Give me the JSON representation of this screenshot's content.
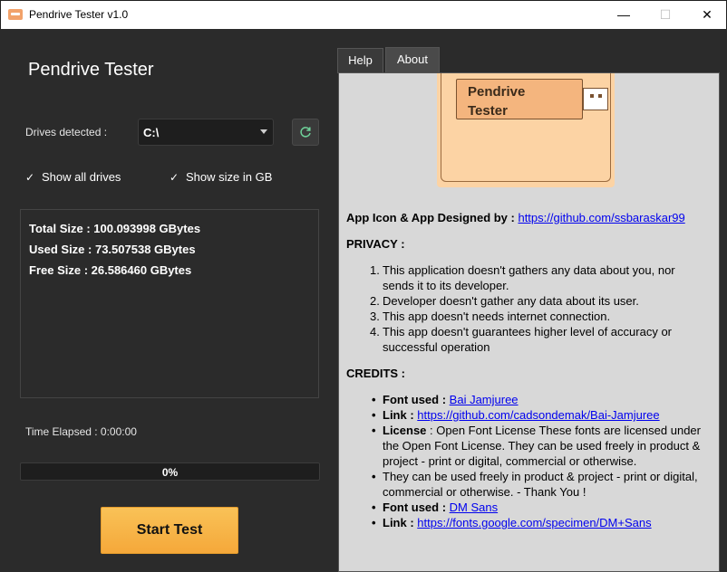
{
  "window": {
    "title": "Pendrive Tester v1.0",
    "minimize_glyph": "—",
    "maximize_glyph": "☐",
    "close_glyph": "✕"
  },
  "left": {
    "app_title": "Pendrive Tester",
    "drives_label": "Drives detected :",
    "drive_value": "C:\\",
    "refresh_icon": "refresh-icon",
    "show_all_drives": {
      "mark": "✓",
      "label": "Show all drives",
      "checked": true
    },
    "show_size_gb": {
      "mark": "✓",
      "label": "Show size in GB",
      "checked": true
    },
    "info": {
      "total": "Total Size : 100.093998 GBytes",
      "used": "Used Size : 73.507538 GBytes",
      "free": "Free Size : 26.586460 GBytes"
    },
    "time_elapsed": "Time Elapsed : 0:00:00",
    "progress_percent": 0,
    "progress_label": "0%",
    "start_button": "Start Test"
  },
  "tabs": [
    {
      "label": "Help",
      "active": false
    },
    {
      "label": "About",
      "active": true
    }
  ],
  "about": {
    "logo_text_line1": "Pendrive",
    "logo_text_line2": "Tester",
    "designer_label": "App Icon & App Designed by : ",
    "designer_link": "https://github.com/ssbaraskar99",
    "privacy_heading": "PRIVACY :",
    "privacy_items": [
      {
        "num": "1.",
        "text": "This application doesn't gathers any data about you, nor sends it to its developer."
      },
      {
        "num": "2.",
        "text": "Developer doesn't gather any data about its user."
      },
      {
        "num": "3.",
        "text": "This app doesn't needs internet connection."
      },
      {
        "num": "4.",
        "text": "This app doesn't guarantees higher level of accuracy or successful operation"
      }
    ],
    "credits_heading": "CREDITS :",
    "credits": {
      "font1_label": "Font used : ",
      "font1_link": "Bai Jamjuree",
      "link1_label": "Link : ",
      "link1_url": "https://github.com/cadsondemak/Bai-Jamjuree",
      "license_label": "License",
      "license_text": " : Open Font License These fonts are licensed under the Open Font License. They can be used freely in product & project - print or digital, commercial or otherwise.",
      "freely_text": "They can be used freely in product & project - print or digital, commercial or otherwise. - Thank You !",
      "font2_label": "Font used : ",
      "font2_link": "DM Sans",
      "link2_label": "Link : ",
      "link2_url": "https://fonts.google.com/specimen/DM+Sans",
      "bullet": "•"
    }
  },
  "colors": {
    "accent": "#f7b548",
    "background": "#2b2b2b",
    "panel": "#d8d8d8",
    "link": "#0000ee"
  }
}
